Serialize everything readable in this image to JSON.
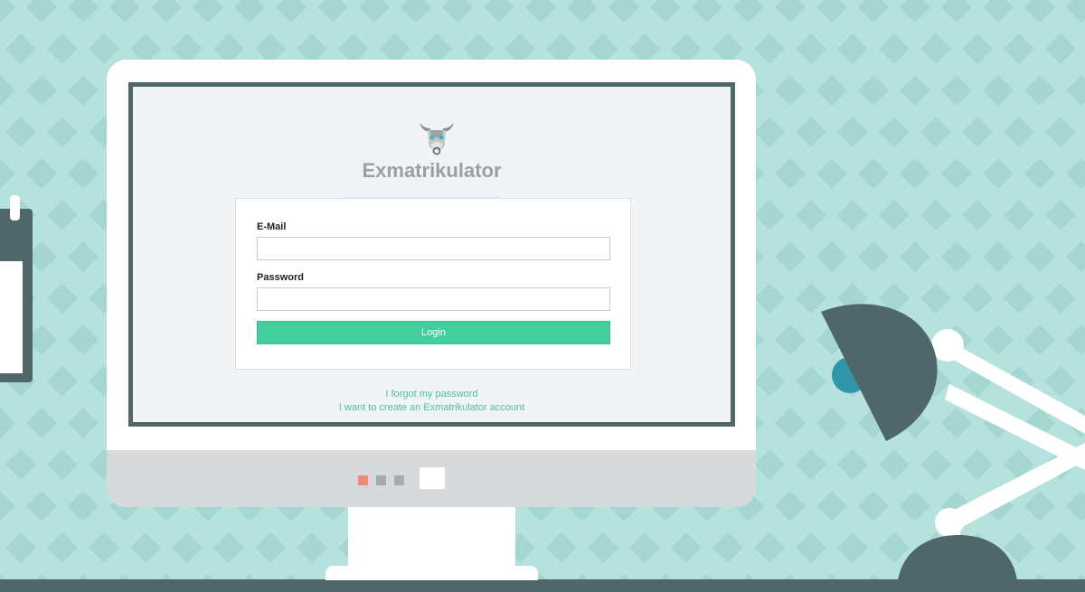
{
  "app": {
    "title": "Exmatrikulator"
  },
  "login_form": {
    "email_label": "E-Mail",
    "email_value": "",
    "password_label": "Password",
    "password_value": "",
    "login_label": "Login"
  },
  "links": {
    "forgot_password": "I forgot my password",
    "create_account": "I want to create an Exmatrikulator account"
  },
  "colors": {
    "accent": "#44ce9e",
    "link": "#4dbf95",
    "background": "#b6e2de",
    "frame": "#4f666b",
    "dot_active": "#f08a78",
    "dot_inactive": "#a9aaac"
  },
  "icons": {
    "logo": "bull-head-icon"
  }
}
